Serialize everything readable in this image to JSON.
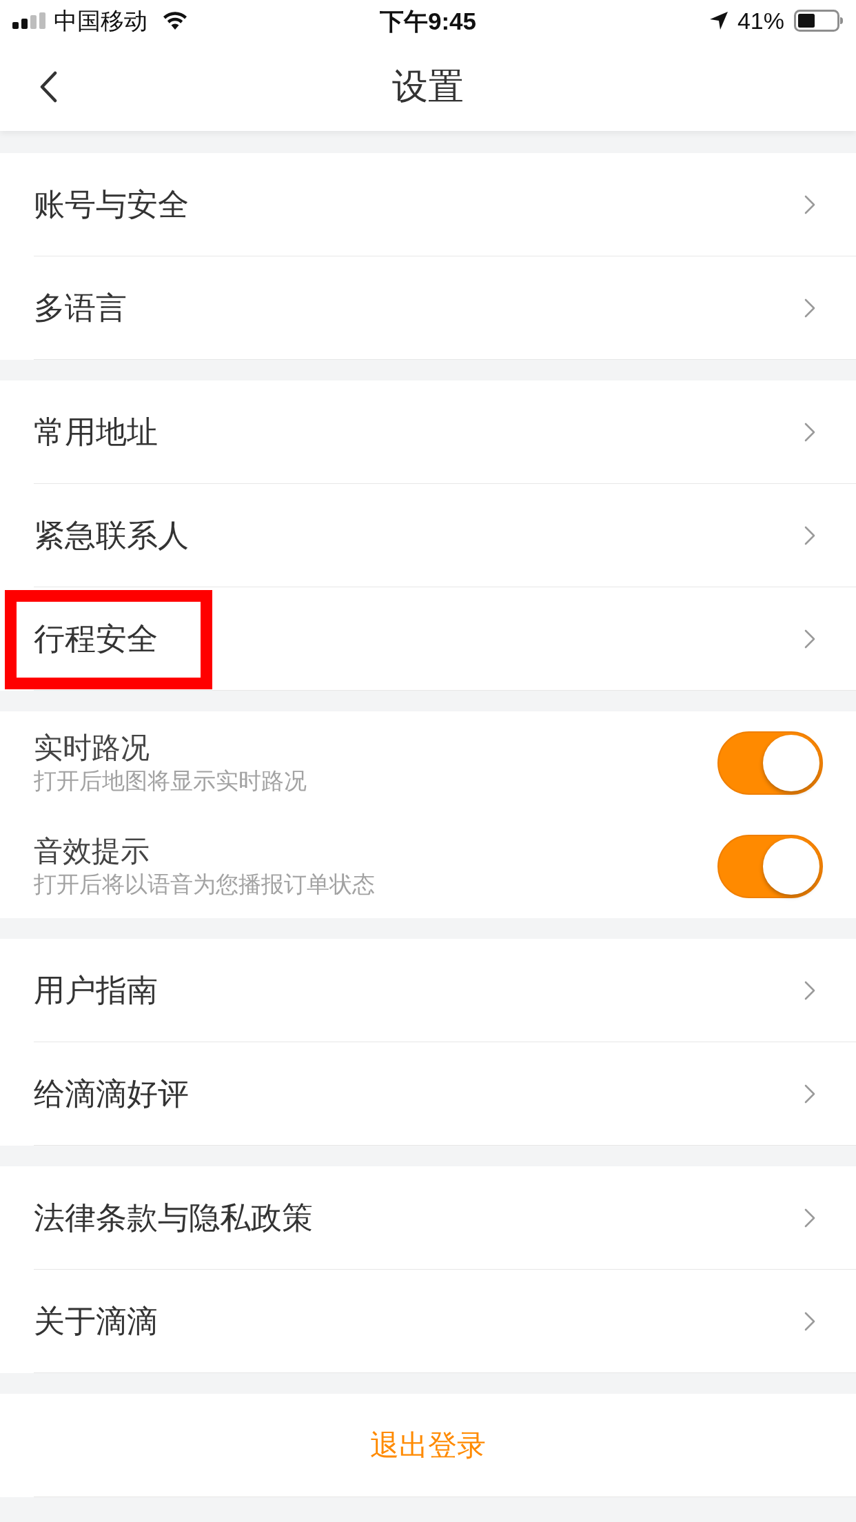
{
  "status_bar": {
    "carrier": "中国移动",
    "time": "下午9:45",
    "battery": "41%"
  },
  "nav_bar": {
    "title": "设置"
  },
  "sections": [
    {
      "items": [
        {
          "kind": "link",
          "label": "账号与安全",
          "highlighted": false
        },
        {
          "kind": "link",
          "label": "多语言",
          "highlighted": false
        }
      ]
    },
    {
      "items": [
        {
          "kind": "link",
          "label": "常用地址",
          "highlighted": false
        },
        {
          "kind": "link",
          "label": "紧急联系人",
          "highlighted": false
        },
        {
          "kind": "link",
          "label": "行程安全",
          "highlighted": true
        }
      ]
    },
    {
      "items": [
        {
          "kind": "toggle",
          "label": "实时路况",
          "description": "打开后地图将显示实时路况",
          "on": true
        },
        {
          "kind": "toggle",
          "label": "音效提示",
          "description": "打开后将以语音为您播报订单状态",
          "on": true
        }
      ]
    },
    {
      "items": [
        {
          "kind": "link",
          "label": "用户指南",
          "highlighted": false
        },
        {
          "kind": "link",
          "label": "给滴滴好评",
          "highlighted": false
        }
      ]
    },
    {
      "items": [
        {
          "kind": "link",
          "label": "法律条款与隐私政策",
          "highlighted": false
        },
        {
          "kind": "link",
          "label": "关于滴滴",
          "highlighted": false
        }
      ]
    }
  ],
  "logout_button": {
    "label": "退出登录"
  }
}
